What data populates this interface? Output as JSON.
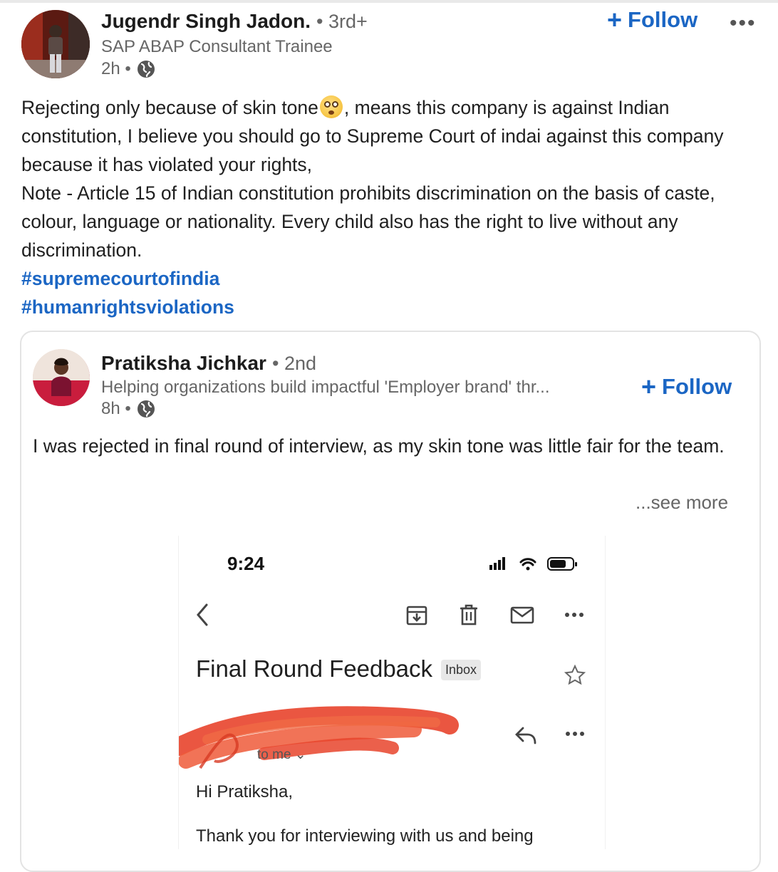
{
  "post": {
    "author": {
      "name": "Jugendr Singh Jadon.",
      "degree": "• 3rd+",
      "headline": "SAP ABAP Consultant Trainee",
      "time": "2h •"
    },
    "follow_label": "Follow",
    "more_label": "•••",
    "body_lines": [
      "Rejecting only because of skin tone",
      ", means this company is against Indian constitution, I believe you should go to Supreme Court of indai against this company because it has violated your rights,",
      "Note - Article 15 of Indian constitution prohibits discrimination on the basis of caste, colour, language or nationality. Every child also has the right to live without any discrimination."
    ],
    "hashtags": [
      "#supremecourtofindia",
      "#humanrightsviolations"
    ]
  },
  "shared": {
    "author": {
      "name": "Pratiksha Jichkar",
      "degree": "• 2nd",
      "headline": "Helping organizations build impactful 'Employer brand' thr...",
      "time": "8h •"
    },
    "follow_label": "Follow",
    "text": "I was rejected in final round of interview, as my skin tone was little fair for the team.",
    "see_more": "...see more"
  },
  "email_screenshot": {
    "time": "9:24",
    "subject": "Final Round Feedback",
    "label": "Inbox",
    "to": "to me ⌄",
    "greeting": "Hi Pratiksha,",
    "line1": "Thank you for interviewing with us and being",
    "icons": [
      "back-icon",
      "archive-icon",
      "trash-icon",
      "mail-icon",
      "more-icon",
      "star-icon",
      "reply-icon"
    ]
  },
  "colors": {
    "link": "#1b66c4",
    "meta": "#666666",
    "redact": "#e8442c"
  }
}
